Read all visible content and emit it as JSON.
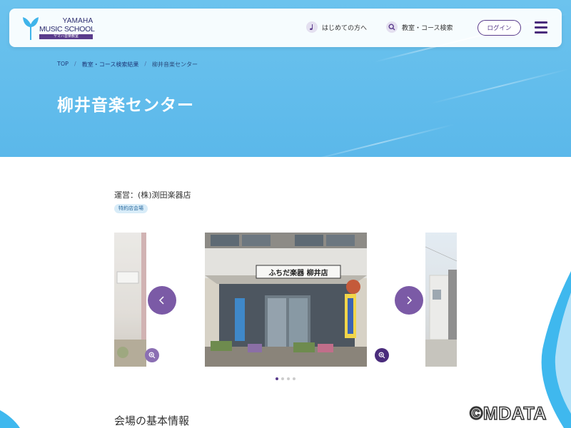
{
  "header": {
    "logo_line1": "YAMAHA",
    "logo_line2": "MUSIC SCHOOL",
    "logo_tag": "ヤマハ音楽教室",
    "nav_beginner": "はじめての方へ",
    "nav_search": "教室・コース検索",
    "login_label": "ログイン",
    "beginner_icon": "music-note-icon",
    "search_icon": "search-icon",
    "menu_icon": "hamburger-menu-icon"
  },
  "breadcrumb": {
    "top": "TOP",
    "sep1": "/",
    "results": "教室・コース検索結果",
    "sep2": "/",
    "current": "柳井音楽センター"
  },
  "page": {
    "title": "柳井音楽センター",
    "operator": "運営：(株)渕田楽器店",
    "badge": "特約店会場",
    "section_title": "会場の基本情報",
    "watermark": "©MDATA"
  },
  "carousel": {
    "store_sign": "ふちだ楽器 柳井店",
    "prev_icon": "chevron-left-icon",
    "next_icon": "chevron-right-icon",
    "zoom_icon": "zoom-in-icon",
    "active_index": 0,
    "dot_count": 4
  },
  "colors": {
    "hero": "#5bb8ea",
    "brand_purple": "#5a3c8c",
    "arrow_purple": "#7b5aa6",
    "badge_bg": "#d8ecf8"
  }
}
